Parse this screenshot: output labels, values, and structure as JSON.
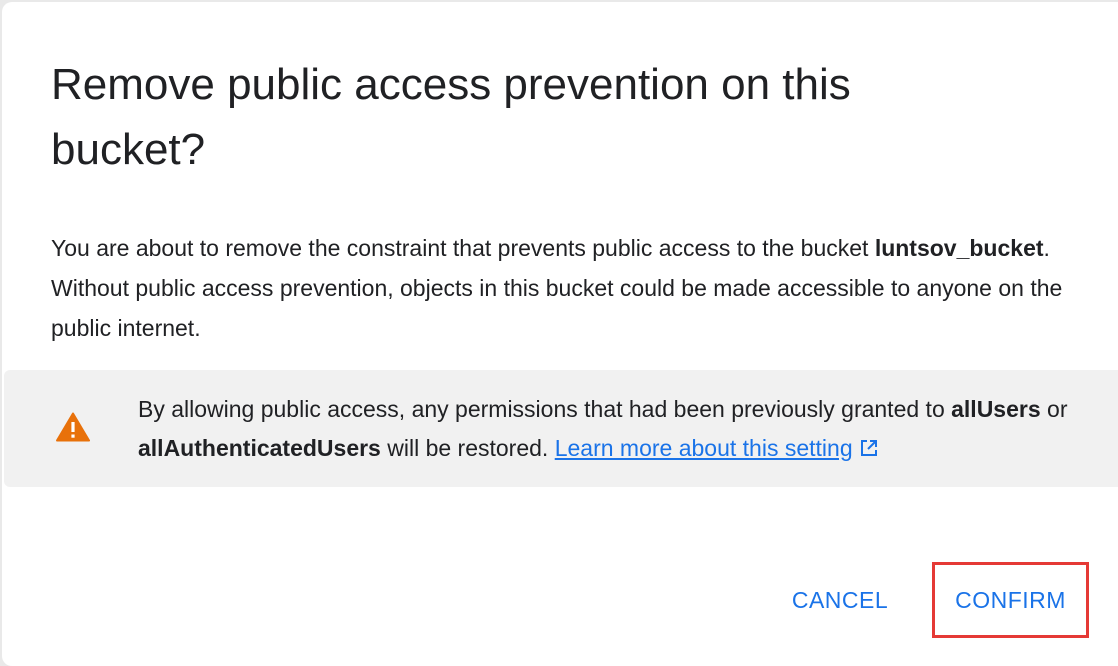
{
  "dialog": {
    "title": "Remove public access prevention on this bucket?",
    "body": {
      "intro": "You are about to remove the constraint that prevents public access to the bucket ",
      "bucket_name": "luntsov_bucket",
      "rest": ". Without public access prevention, objects in this bucket could be made accessible to anyone on the public internet."
    },
    "warning": {
      "icon": "warning-icon",
      "text_before": "By allowing public access, any permissions that had been previously granted to ",
      "all_users": "allUsers",
      "or_text": " or ",
      "all_authenticated_users": "allAuthenticatedUsers",
      "text_after": " will be restored. ",
      "link_text": "Learn more about this setting",
      "link_icon": "external-link-icon",
      "icon_color": "#e8710a",
      "link_color": "#1a73e8"
    },
    "buttons": {
      "cancel_label": "CANCEL",
      "confirm_label": "CONFIRM"
    },
    "highlight_color": "#e53935"
  }
}
